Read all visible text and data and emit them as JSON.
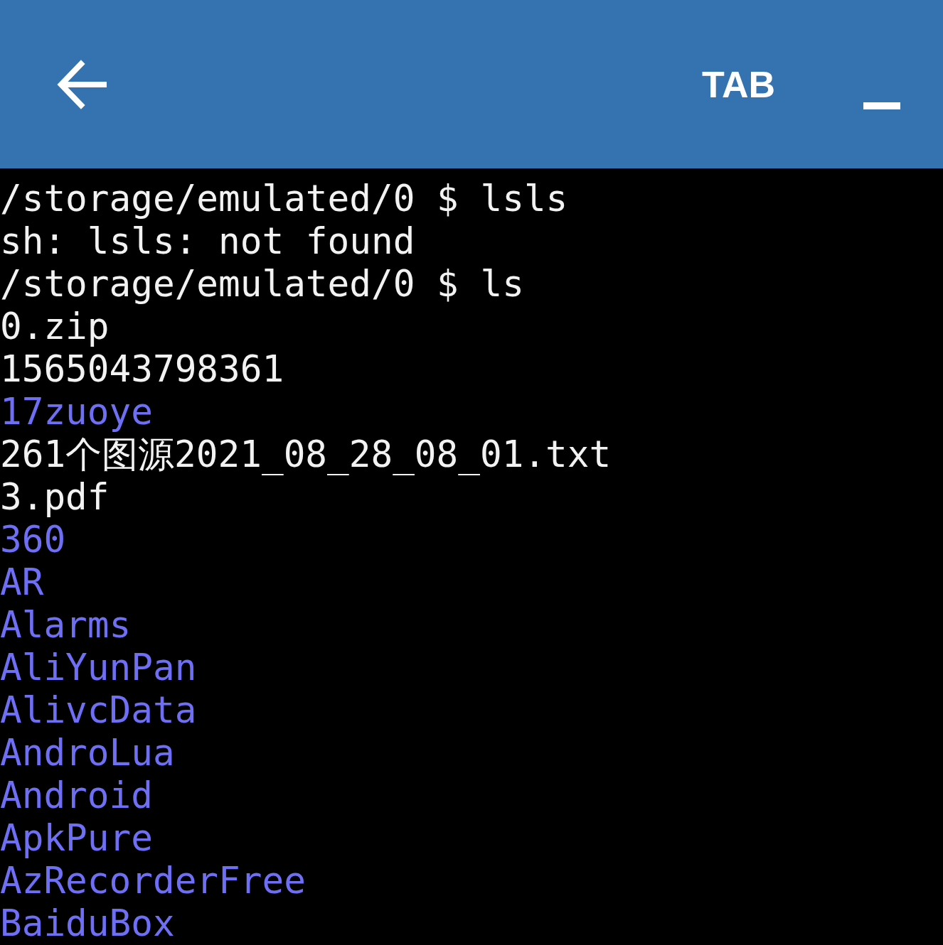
{
  "toolbar": {
    "tab_key": "TAB"
  },
  "terminal": {
    "lines": [
      {
        "kind": "prompt",
        "text": "/storage/emulated/0 $ lsls"
      },
      {
        "kind": "file",
        "text": "sh: lsls: not found"
      },
      {
        "kind": "prompt",
        "text": "/storage/emulated/0 $ ls"
      },
      {
        "kind": "file",
        "text": "0.zip"
      },
      {
        "kind": "file",
        "text": "1565043798361"
      },
      {
        "kind": "dir",
        "text": "17zuoye"
      },
      {
        "kind": "file",
        "text": "261个图源2021_08_28_08_01.txt"
      },
      {
        "kind": "file",
        "text": "3.pdf"
      },
      {
        "kind": "dir",
        "text": "360"
      },
      {
        "kind": "dir",
        "text": "AR"
      },
      {
        "kind": "dir",
        "text": "Alarms"
      },
      {
        "kind": "dir",
        "text": "AliYunPan"
      },
      {
        "kind": "dir",
        "text": "AlivcData"
      },
      {
        "kind": "dir",
        "text": "AndroLua"
      },
      {
        "kind": "dir",
        "text": "Android"
      },
      {
        "kind": "dir",
        "text": "ApkPure"
      },
      {
        "kind": "dir",
        "text": "AzRecorderFree"
      },
      {
        "kind": "dir",
        "text": "BaiduBox"
      }
    ]
  }
}
